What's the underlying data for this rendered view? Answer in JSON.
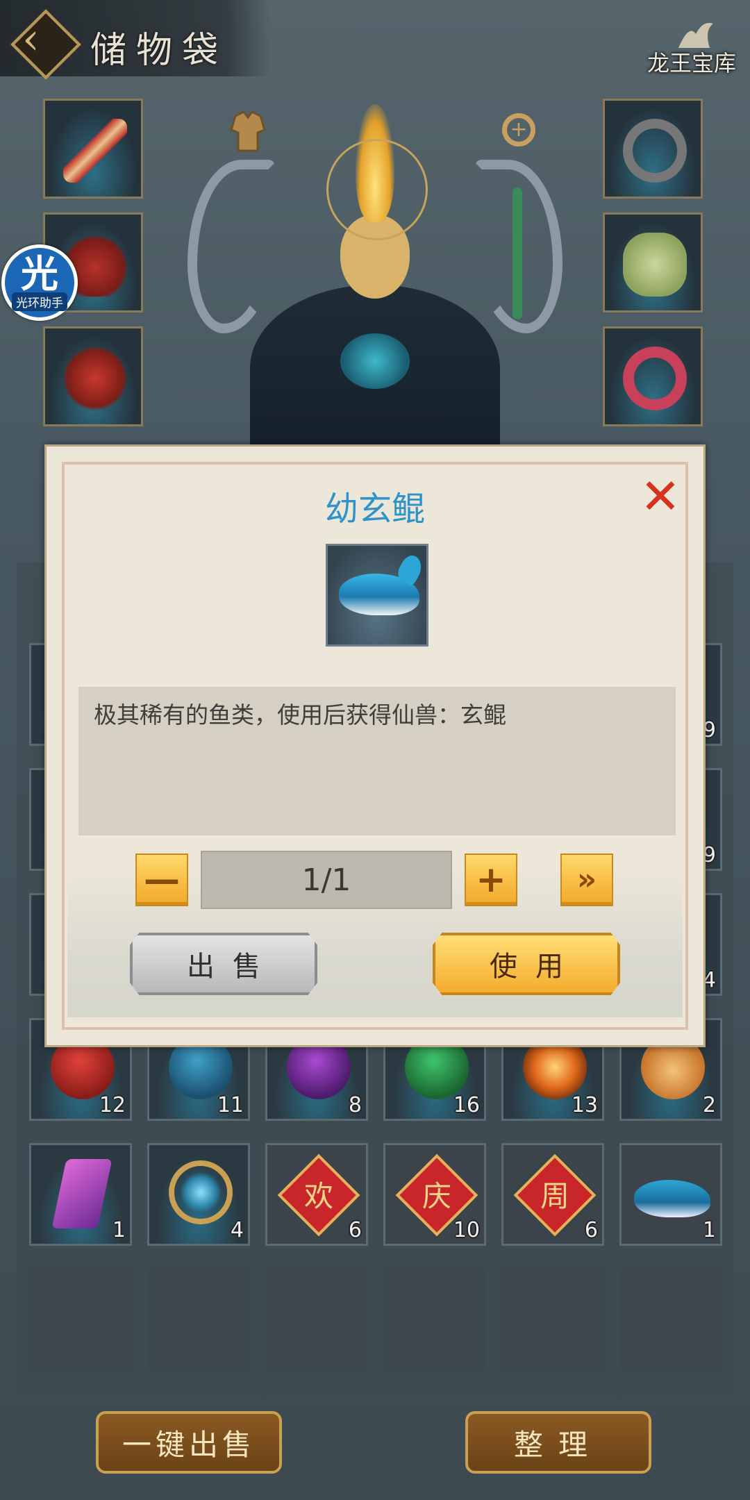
{
  "header": {
    "title": "储物袋",
    "logo_text": "龙王宝库"
  },
  "helper_badge": {
    "glyph": "光",
    "label": "光环助手"
  },
  "icons": {
    "back": "back-arrow-icon",
    "armor": "armor-icon",
    "zoom": "zoom-in-icon",
    "close": "close-icon",
    "plus": "plus-icon",
    "minus": "minus-icon",
    "max": "double-chevron-right-icon"
  },
  "equipment_left": [
    "sword",
    "helmet",
    "armor-robe"
  ],
  "equipment_right": [
    "bracelet",
    "jade-pendant",
    "ring"
  ],
  "bag": {
    "row_a": [
      {
        "item": "red-seed-egg",
        "count": "12"
      },
      {
        "item": "blue-seed-egg",
        "count": "11"
      },
      {
        "item": "purple-seed-egg",
        "count": "8"
      },
      {
        "item": "green-seed-egg",
        "count": "16"
      },
      {
        "item": "fire-orb",
        "count": "13"
      },
      {
        "item": "lucky-pouch",
        "count": "2"
      }
    ],
    "row_b": [
      {
        "item": "pink-crystal",
        "count": "1"
      },
      {
        "item": "gold-ring-orb",
        "count": "4"
      },
      {
        "item": "char-card",
        "glyph": "欢",
        "count": "6"
      },
      {
        "item": "char-card",
        "glyph": "庆",
        "count": "10"
      },
      {
        "item": "char-card",
        "glyph": "周",
        "count": "6"
      },
      {
        "item": "whale-fish",
        "count": "1"
      }
    ],
    "partial_counts_right": [
      "9",
      "9",
      "4"
    ]
  },
  "buttons": {
    "sell_all": "一键出售",
    "sort": "整理"
  },
  "dialog": {
    "title": "幼玄鲲",
    "description": "极其稀有的鱼类，使用后获得仙兽：玄鲲",
    "quantity": "1/1",
    "minus_label": "—",
    "plus_label": "+",
    "max_label": "»",
    "sell_label": "出售",
    "use_label": "使用",
    "close_label": "✕"
  },
  "colors": {
    "title_blue": "#2e93c9",
    "close_red": "#d8321e",
    "gold_button": "#f4aa2a",
    "gray_button": "#b6b6b6"
  }
}
